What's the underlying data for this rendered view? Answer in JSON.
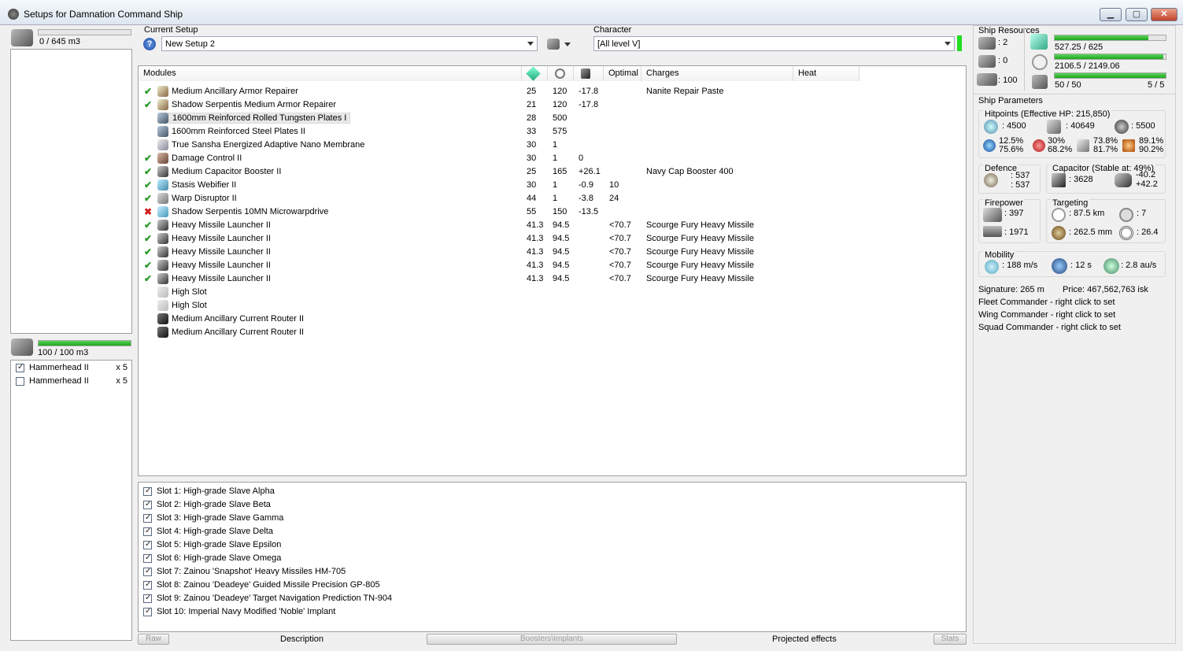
{
  "window": {
    "title": "Setups for Damnation Command Ship",
    "min": "▁",
    "max": "▢",
    "close": "✕"
  },
  "cargo": {
    "text": "0 / 645 m3",
    "fill": 0
  },
  "drones": {
    "bay_text": "100 / 100 m3",
    "fill": 1.0,
    "items": [
      {
        "name": "Hammerhead II",
        "qty": "x 5",
        "checked": true
      },
      {
        "name": "Hammerhead II",
        "qty": "x 5",
        "checked": false
      }
    ]
  },
  "setup": {
    "label": "Current Setup",
    "value": "New Setup 2",
    "help": "?"
  },
  "character": {
    "label": "Character",
    "value": "[All level V]"
  },
  "modules": {
    "headers": [
      "Modules",
      "",
      "",
      "",
      "Optimal",
      "Charges",
      "Heat"
    ],
    "rows": [
      {
        "status": "ok",
        "icon": "armor-repairer-icon",
        "name": "Medium Ancillary Armor Repairer",
        "c1": "25",
        "c2": "120",
        "c3": "-17.8",
        "opt": "",
        "charge": "Nanite Repair Paste"
      },
      {
        "status": "ok",
        "icon": "armor-repairer-icon",
        "name": "Shadow Serpentis Medium Armor Repairer",
        "c1": "21",
        "c2": "120",
        "c3": "-17.8",
        "opt": "",
        "charge": ""
      },
      {
        "status": "",
        "icon": "armor-plate-icon",
        "name": "1600mm Reinforced Rolled Tungsten Plates I",
        "c1": "28",
        "c2": "500",
        "c3": "",
        "opt": "",
        "charge": "",
        "selected": true
      },
      {
        "status": "",
        "icon": "armor-plate-icon",
        "name": "1600mm Reinforced Steel Plates II",
        "c1": "33",
        "c2": "575",
        "c3": "",
        "opt": "",
        "charge": ""
      },
      {
        "status": "",
        "icon": "membrane-icon",
        "name": "True Sansha Energized Adaptive Nano Membrane",
        "c1": "30",
        "c2": "1",
        "c3": "",
        "opt": "",
        "charge": ""
      },
      {
        "status": "ok",
        "icon": "damage-control-icon",
        "name": "Damage Control II",
        "c1": "30",
        "c2": "1",
        "c3": "0",
        "opt": "",
        "charge": ""
      },
      {
        "status": "ok",
        "icon": "cap-booster-icon",
        "name": "Medium Capacitor Booster II",
        "c1": "25",
        "c2": "165",
        "c3": "+26.1",
        "opt": "",
        "charge": "Navy Cap Booster 400"
      },
      {
        "status": "ok",
        "icon": "webifier-icon",
        "name": "Stasis Webifier II",
        "c1": "30",
        "c2": "1",
        "c3": "-0.9",
        "opt": "10",
        "charge": ""
      },
      {
        "status": "ok",
        "icon": "disruptor-icon",
        "name": "Warp Disruptor II",
        "c1": "44",
        "c2": "1",
        "c3": "-3.8",
        "opt": "24",
        "charge": ""
      },
      {
        "status": "bad",
        "icon": "microwarpdrive-icon",
        "name": "Shadow Serpentis 10MN Microwarpdrive",
        "c1": "55",
        "c2": "150",
        "c3": "-13.5",
        "opt": "",
        "charge": ""
      },
      {
        "status": "ok",
        "icon": "missile-launcher-icon",
        "name": "Heavy Missile Launcher II",
        "c1": "41.3",
        "c2": "94.5",
        "c3": "",
        "opt": "<70.7",
        "charge": "Scourge Fury Heavy Missile"
      },
      {
        "status": "ok",
        "icon": "missile-launcher-icon",
        "name": "Heavy Missile Launcher II",
        "c1": "41.3",
        "c2": "94.5",
        "c3": "",
        "opt": "<70.7",
        "charge": "Scourge Fury Heavy Missile"
      },
      {
        "status": "ok",
        "icon": "missile-launcher-icon",
        "name": "Heavy Missile Launcher II",
        "c1": "41.3",
        "c2": "94.5",
        "c3": "",
        "opt": "<70.7",
        "charge": "Scourge Fury Heavy Missile"
      },
      {
        "status": "ok",
        "icon": "missile-launcher-icon",
        "name": "Heavy Missile Launcher II",
        "c1": "41.3",
        "c2": "94.5",
        "c3": "",
        "opt": "<70.7",
        "charge": "Scourge Fury Heavy Missile"
      },
      {
        "status": "ok",
        "icon": "missile-launcher-icon",
        "name": "Heavy Missile Launcher II",
        "c1": "41.3",
        "c2": "94.5",
        "c3": "",
        "opt": "<70.7",
        "charge": "Scourge Fury Heavy Missile"
      },
      {
        "status": "",
        "icon": "high-slot-icon",
        "name": "High Slot",
        "c1": "",
        "c2": "",
        "c3": "",
        "opt": "",
        "charge": ""
      },
      {
        "status": "",
        "icon": "high-slot-icon",
        "name": "High Slot",
        "c1": "",
        "c2": "",
        "c3": "",
        "opt": "",
        "charge": ""
      },
      {
        "status": "",
        "icon": "rig-icon",
        "name": "Medium Ancillary Current Router II",
        "c1": "",
        "c2": "",
        "c3": "",
        "opt": "",
        "charge": ""
      },
      {
        "status": "",
        "icon": "rig-icon",
        "name": "Medium Ancillary Current Router II",
        "c1": "",
        "c2": "",
        "c3": "",
        "opt": "",
        "charge": ""
      }
    ]
  },
  "implants": [
    "Slot 1: High-grade Slave Alpha",
    "Slot 2: High-grade Slave Beta",
    "Slot 3: High-grade Slave Gamma",
    "Slot 4: High-grade Slave Delta",
    "Slot 5: High-grade Slave Epsilon",
    "Slot 6: High-grade Slave Omega",
    "Slot 7: Zainou 'Snapshot' Heavy Missiles HM-705",
    "Slot 8: Zainou 'Deadeye' Guided Missile Precision GP-805",
    "Slot 9: Zainou 'Deadeye' Target Navigation Prediction TN-904",
    "Slot 10: Imperial Navy Modified 'Noble' Implant"
  ],
  "bottom_tabs": {
    "raw": "Raw",
    "description": "Description",
    "boosters": "Boosters\\Implants",
    "projected": "Projected effects",
    "stats": "Stats"
  },
  "resources": {
    "title": "Ship Resources",
    "turrets": ": 2",
    "launchers": ": 0",
    "calibration": ": 100",
    "cpu": {
      "text": "527.25 / 625",
      "fill": 0.8436
    },
    "powergrid": {
      "text": "2106.5 / 2149.06",
      "fill": 0.9802
    },
    "drone_bw": {
      "text": "50 / 50",
      "fill": 1.0
    },
    "drones_active": "5 / 5"
  },
  "params": {
    "title": "Ship Parameters",
    "hitpoints_title": "Hitpoints (Effective HP: 215,850)",
    "shield_hp": ": 4500",
    "armor_hp": ": 40649",
    "structure_hp": ": 5500",
    "resists": {
      "em_shield": "12.5%",
      "em_armor": "75.6%",
      "therm_shield": "30%",
      "therm_armor": "68.2%",
      "kin_shield": "73.8%",
      "kin_armor": "81.7%",
      "exp_shield": "89.1%",
      "exp_armor": "90.2%"
    },
    "defence_title": "Defence",
    "defence_1": ": 537",
    "defence_2": ": 537",
    "capacitor_title": "Capacitor (Stable at: 49%)",
    "cap_amount": ": 3628",
    "cap_delta_1": "-40.2",
    "cap_delta_2": "+42.2",
    "firepower_title": "Firepower",
    "dps": ": 397",
    "volley": ": 1971",
    "targeting_title": "Targeting",
    "lock_range": ": 87.5 km",
    "max_targets": ": 7",
    "scan_res": ": 262.5 mm",
    "sensor": ": 26.4",
    "mobility_title": "Mobility",
    "speed": ": 188 m/s",
    "align": ": 12 s",
    "warp": ": 2.8 au/s",
    "signature": "Signature: 265 m",
    "price": "Price: 467,562,763 isk",
    "fleet": "Fleet Commander - right click to set",
    "wing": "Wing Commander - right click to set",
    "squad": "Squad Commander - right click to set"
  }
}
